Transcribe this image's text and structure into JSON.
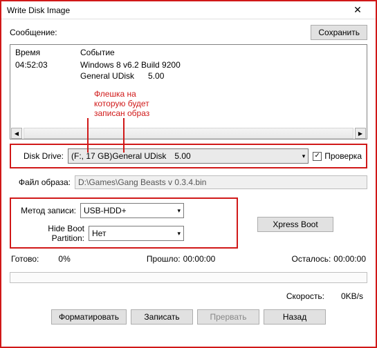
{
  "window": {
    "title": "Write Disk Image"
  },
  "top": {
    "message_label": "Сообщение:",
    "save_btn": "Сохранить"
  },
  "log": {
    "col_time": "Время",
    "col_event": "Событие",
    "time": "04:52:03",
    "line1": "Windows 8 v6.2 Build 9200",
    "line2a": "General UDisk",
    "line2b": "5.00"
  },
  "annot": {
    "l1": "Флешка на",
    "l2": "которую будет",
    "l3": "записан образ"
  },
  "drive": {
    "label": "Disk Drive:",
    "value_a": "(F:, 17 GB)General UDisk",
    "value_b": "5.00",
    "check_label": "Проверка"
  },
  "image": {
    "label": "Файл образа:",
    "value": "D:\\Games\\Gang Beasts v 0.3.4.bin"
  },
  "method": {
    "label": "Метод записи:",
    "value": "USB-HDD+"
  },
  "hide": {
    "label": "Hide Boot Partition:",
    "value": "Нет"
  },
  "xpress": "Xpress Boot",
  "stats": {
    "ready": "Готово:",
    "ready_v": "0%",
    "elapsed": "Прошло:",
    "elapsed_v": "00:00:00",
    "remain": "Осталось:",
    "remain_v": "00:00:00"
  },
  "speed": {
    "label": "Скорость:",
    "value": "0KB/s"
  },
  "buttons": {
    "format": "Форматировать",
    "write": "Записать",
    "abort": "Прервать",
    "back": "Назад"
  }
}
